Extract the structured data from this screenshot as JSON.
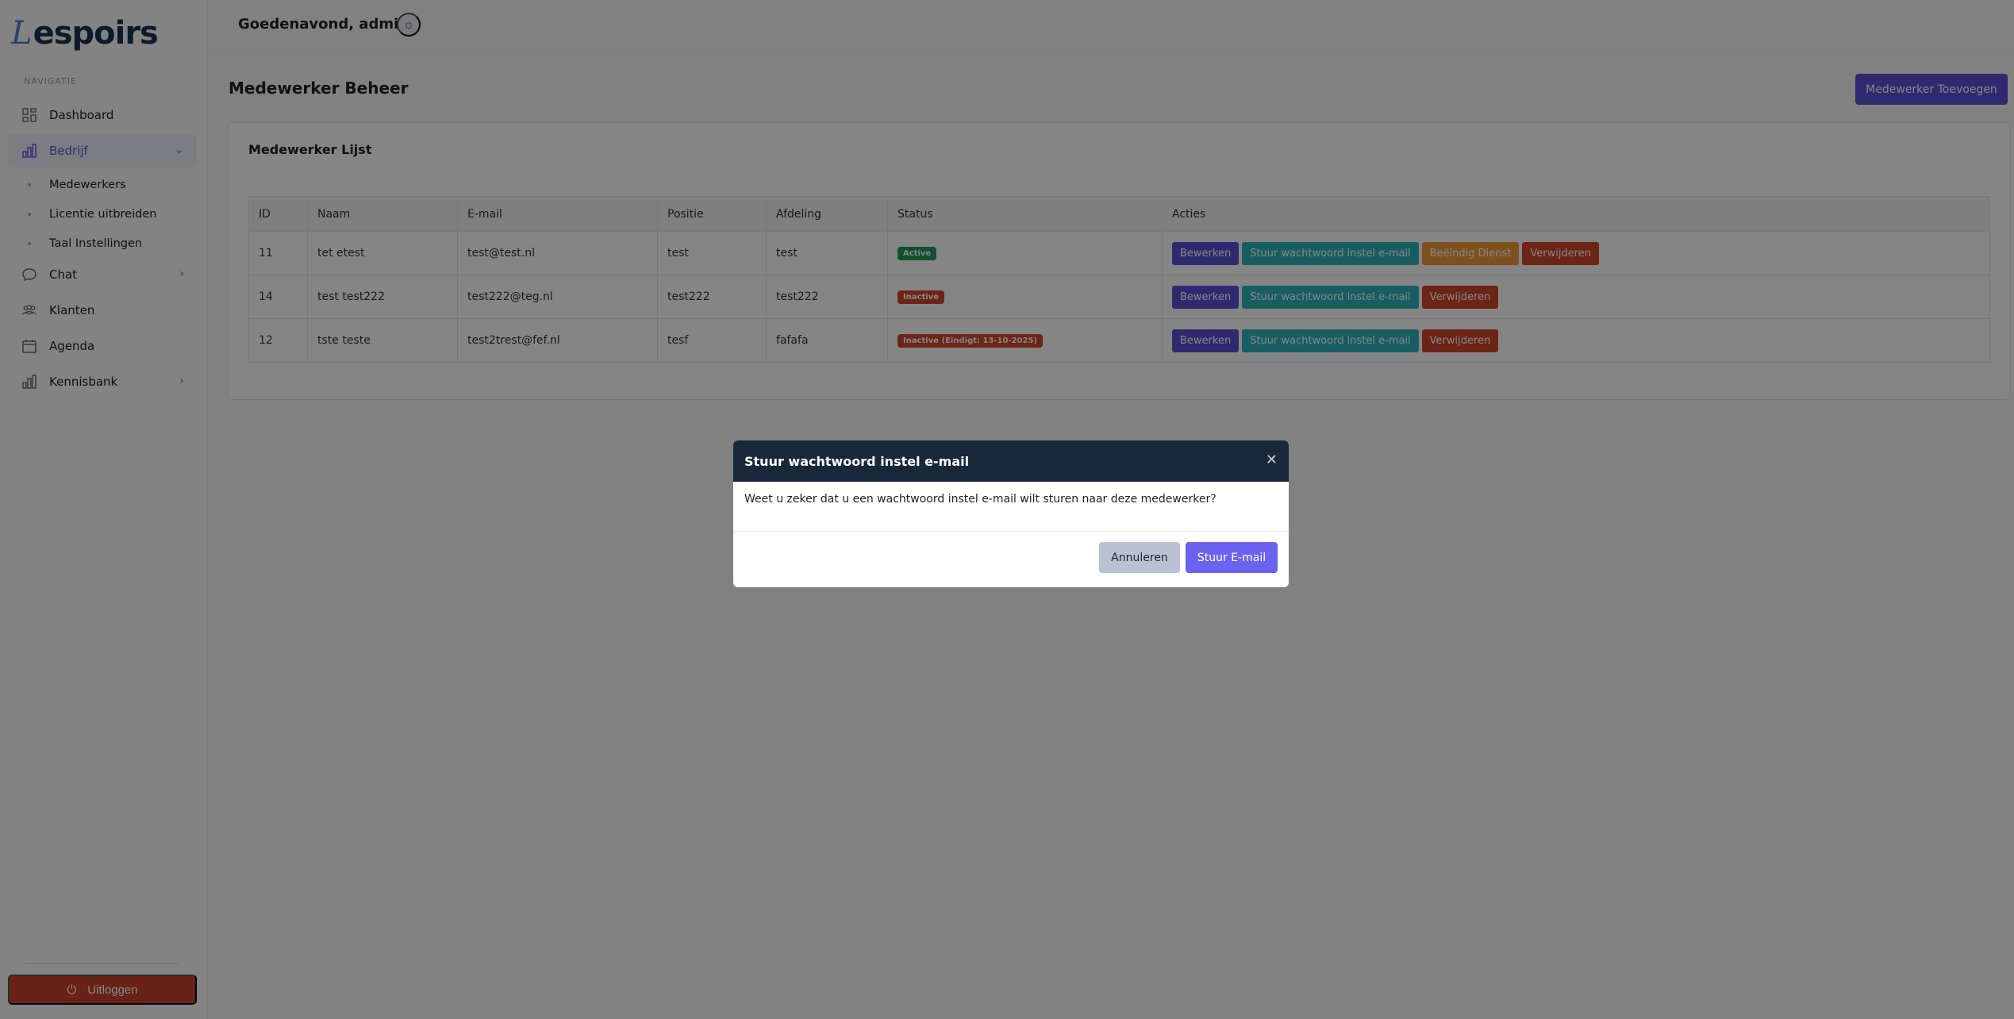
{
  "brand": {
    "mark": "L",
    "name": "espoirs"
  },
  "sidebar": {
    "heading": "NAVIGATIE",
    "items": [
      {
        "label": "Dashboard",
        "icon": "dashboard-icon"
      },
      {
        "label": "Bedrijf",
        "icon": "bar-chart-icon",
        "expanded": true
      },
      {
        "label": "Chat",
        "icon": "chat-icon"
      },
      {
        "label": "Klanten",
        "icon": "users-icon"
      },
      {
        "label": "Agenda",
        "icon": "calendar-icon"
      },
      {
        "label": "Kennisbank",
        "icon": "bar-chart-icon"
      }
    ],
    "subitems": [
      "Medewerkers",
      "Licentie uitbreiden",
      "Taal Instellingen"
    ],
    "logout": "Uitloggen"
  },
  "header": {
    "greeting": "Goedenavond, admin!"
  },
  "main": {
    "title": "Medewerker Beheer",
    "add_button": "Medewerker Toevoegen",
    "card_title": "Medewerker Lijst",
    "columns": [
      "ID",
      "Naam",
      "E-mail",
      "Positie",
      "Afdeling",
      "Status",
      "Acties"
    ],
    "rows": [
      {
        "id": "11",
        "name": "tet etest",
        "email": "test@test.nl",
        "position": "test",
        "department": "test",
        "status": "Active",
        "status_color": "#1f9a5a"
      },
      {
        "id": "14",
        "name": "test test222",
        "email": "test222@teg.nl",
        "position": "test222",
        "department": "test222",
        "status": "Inactive",
        "status_color": "#d0452b"
      },
      {
        "id": "12",
        "name": "tste teste",
        "email": "test2trest@fef.nl",
        "position": "tesf",
        "department": "fafafa",
        "status": "Inactive (Eindigt: 13-10-2025)",
        "status_color": "#d0452b"
      }
    ],
    "actions": {
      "edit": "Bewerken",
      "mail": "Stuur wachtwoord instel e-mail",
      "end": "Beëindig Dienst",
      "delete": "Verwijderen"
    }
  },
  "modal": {
    "title": "Stuur wachtwoord instel e-mail",
    "message": "Weet u zeker dat u een wachtwoord instel e-mail wilt sturen naar deze medewerker?",
    "cancel": "Annuleren",
    "confirm": "Stuur E-mail"
  }
}
